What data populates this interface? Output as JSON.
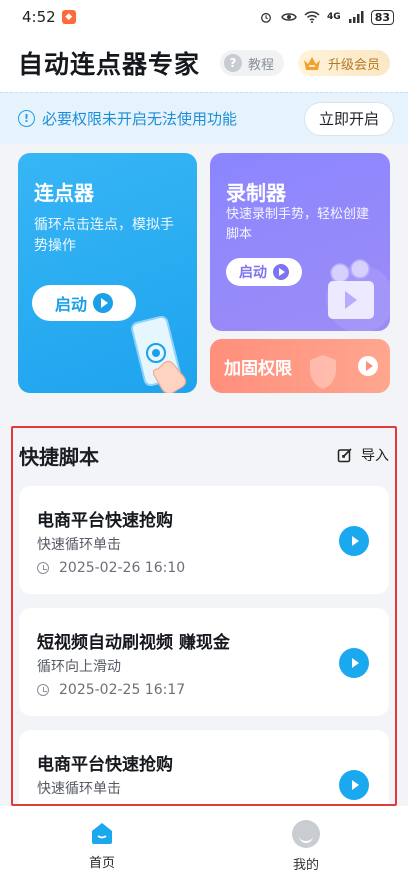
{
  "status_bar": {
    "time": "4:52",
    "battery": "83",
    "network": "4G"
  },
  "header": {
    "title": "自动连点器专家",
    "tutorial_label": "教程",
    "vip_label": "升级会员"
  },
  "notice": {
    "text": "必要权限未开启无法使用功能",
    "button_label": "立即开启"
  },
  "cards": {
    "clicker": {
      "title": "连点器",
      "desc": "循环点击连点，模拟手势操作",
      "button": "启动"
    },
    "recorder": {
      "title": "录制器",
      "desc": "快速录制手势，轻松创建脚本",
      "button": "启动"
    },
    "reinforce": {
      "title": "加固权限"
    }
  },
  "scripts": {
    "title": "快捷脚本",
    "import_label": "导入",
    "items": [
      {
        "name": "电商平台快速抢购",
        "mode": "快速循环单击",
        "time": "2025-02-26 16:10"
      },
      {
        "name": "短视频自动刷视频 赚现金",
        "mode": "循环向上滑动",
        "time": "2025-02-25 16:17"
      },
      {
        "name": "电商平台快速抢购",
        "mode": "快速循环单击",
        "time": ""
      }
    ]
  },
  "tabbar": {
    "home": "首页",
    "mine": "我的"
  },
  "colors": {
    "accent": "#1aa8ee",
    "recorder": "#8b86ff",
    "reinforce": "#ff8f7c",
    "highlight_border": "#e23b3b"
  }
}
